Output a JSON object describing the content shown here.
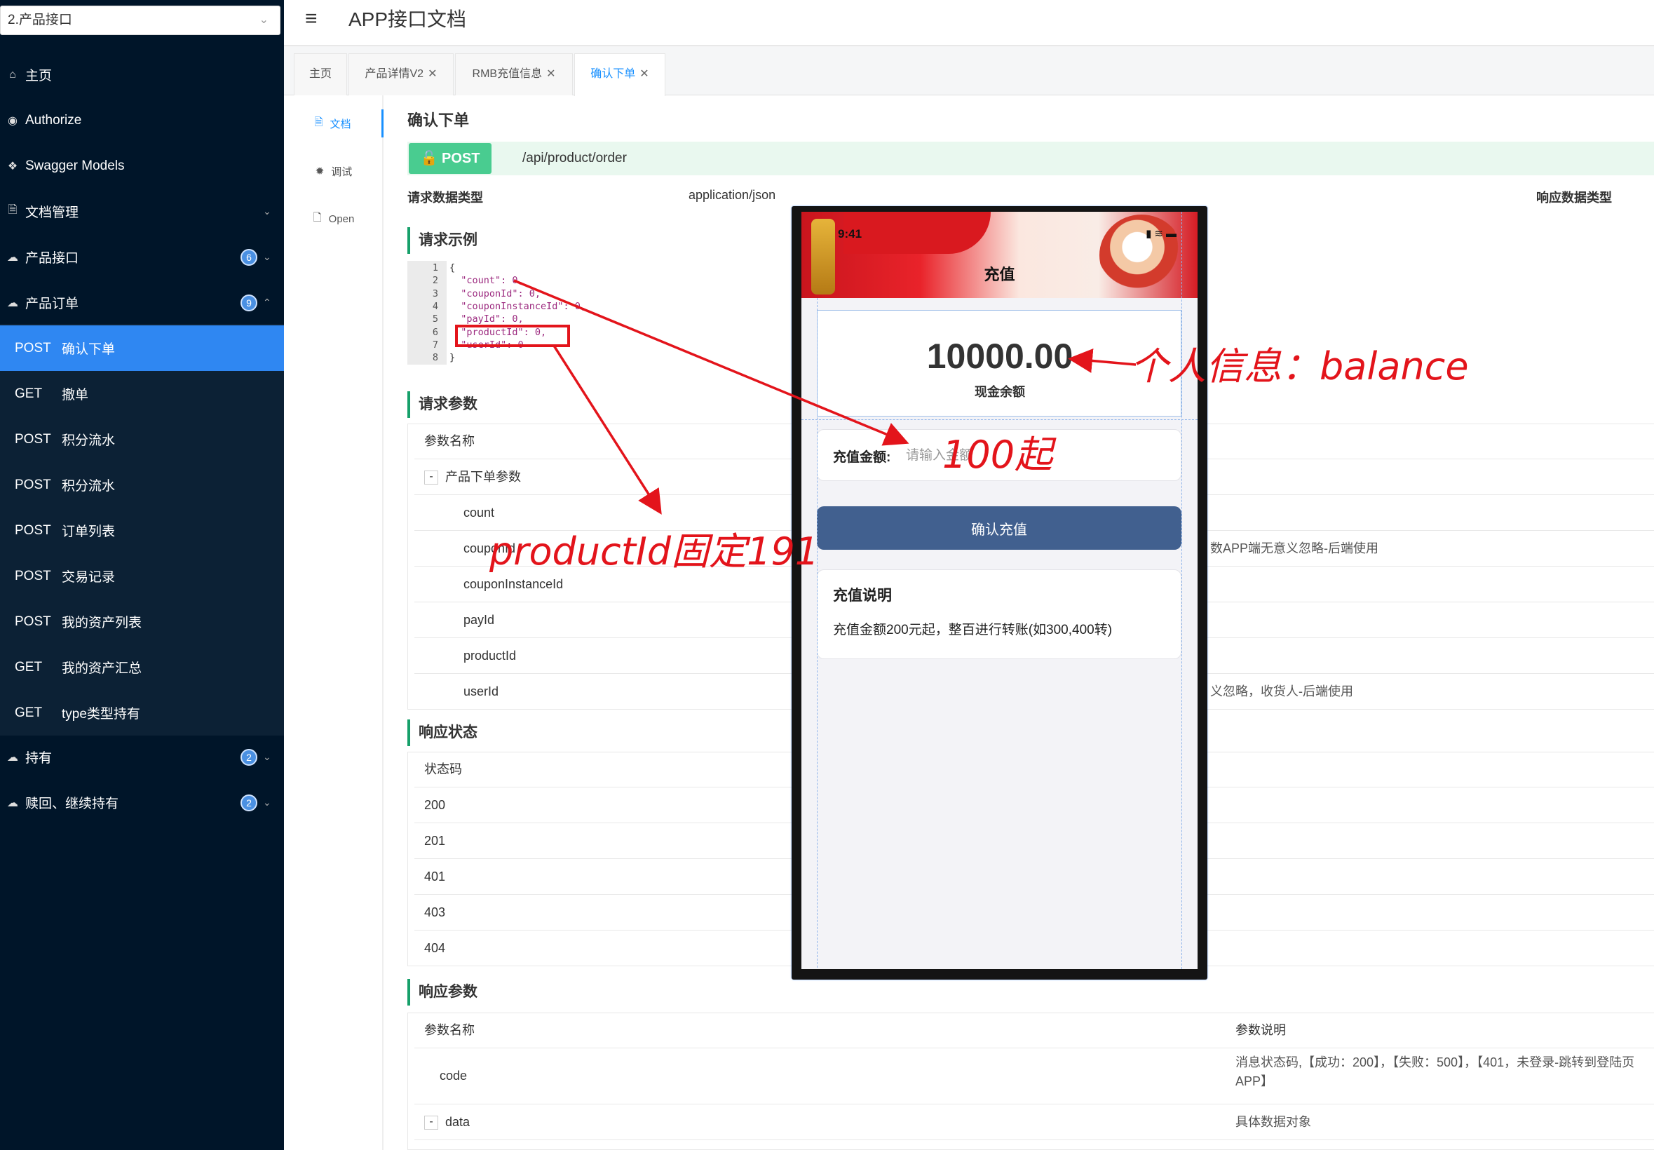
{
  "sidebar": {
    "group_select": "2.产品接口",
    "items": [
      {
        "icon": "home-icon",
        "label": "主页"
      },
      {
        "icon": "lock-icon",
        "label": "Authorize"
      },
      {
        "icon": "cube-icon",
        "label": "Swagger Models"
      },
      {
        "icon": "document-icon",
        "label": "文档管理"
      },
      {
        "icon": "cloud-icon",
        "label": "产品接口",
        "badge": "6"
      },
      {
        "icon": "cloud-icon",
        "label": "产品订单",
        "badge": "9"
      },
      {
        "icon": "cloud-icon",
        "label": "持有",
        "badge": "2"
      },
      {
        "icon": "cloud-icon",
        "label": "赎回、继续持有",
        "badge": "2"
      }
    ],
    "sub_items": [
      {
        "method": "POST",
        "label": "确认下单"
      },
      {
        "method": "GET",
        "label": "撤单"
      },
      {
        "method": "POST",
        "label": "积分流水"
      },
      {
        "method": "POST",
        "label": "积分流水"
      },
      {
        "method": "POST",
        "label": "订单列表"
      },
      {
        "method": "POST",
        "label": "交易记录"
      },
      {
        "method": "POST",
        "label": "我的资产列表"
      },
      {
        "method": "GET",
        "label": "我的资产汇总"
      },
      {
        "method": "GET",
        "label": "type类型持有"
      }
    ]
  },
  "header": {
    "title": "APP接口文档"
  },
  "tabs": [
    "主页",
    "产品详情V2",
    "RMB充值信息",
    "确认下单"
  ],
  "vtabs": [
    "文档",
    "调试",
    "Open"
  ],
  "doc": {
    "title": "确认下单",
    "method": "POST",
    "path": "/api/product/order",
    "req_type_label": "请求数据类型",
    "req_type_value": "application/json",
    "resp_type_label": "响应数据类型",
    "sec_example": "请求示例",
    "code_lines": [
      "{",
      "  \"count\": 0,",
      "  \"couponId\": 0,",
      "  \"couponInstanceId\": 0,",
      "  \"payId\": 0,",
      "  \"productId\": 0,",
      "  \"userId\": 0",
      "}"
    ],
    "sec_params": "请求参数",
    "params_header": "参数名称",
    "params_group": "产品下单参数",
    "params": [
      {
        "name": "count",
        "desc": ""
      },
      {
        "name": "couponId",
        "desc": "数APP端无意义忽略-后端使用"
      },
      {
        "name": "couponInstanceId",
        "desc": ""
      },
      {
        "name": "payId",
        "desc": ""
      },
      {
        "name": "productId",
        "desc": ""
      },
      {
        "name": "userId",
        "desc": "义忽略，收货人-后端使用"
      }
    ],
    "sec_status": "响应状态",
    "status_header": "状态码",
    "status_codes": [
      "200",
      "201",
      "401",
      "403",
      "404"
    ],
    "sec_resp": "响应参数",
    "resp_header_name": "参数名称",
    "resp_header_desc": "参数说明",
    "resp_rows": [
      {
        "name": "code",
        "desc1": "消息状态码,【成功：200】，【失败：500】，【401，未登录-跳转到登陆页",
        "desc2": "APP】"
      },
      {
        "name": "data",
        "desc1": "具体数据对象",
        "desc2": ""
      }
    ]
  },
  "phone": {
    "time": "9:41",
    "title": "充值",
    "balance": "10000.00",
    "balance_label": "现金余额",
    "amount_label": "充值金额:",
    "amount_placeholder": "请输入金额",
    "confirm_label": "确认充值",
    "note_title": "充值说明",
    "note_text": "充值金额200元起，整百进行转账(如300,400转)"
  },
  "annotations": {
    "balance": "个人信息：balance",
    "min_amount": "100起",
    "product": "productId固定191"
  },
  "colors": {
    "sidebar_bg": "#001529",
    "active_nav": "#2f87f2",
    "post_green": "#49cc90",
    "annotation_red": "#e3141b",
    "confirm_button": "#41608f"
  }
}
